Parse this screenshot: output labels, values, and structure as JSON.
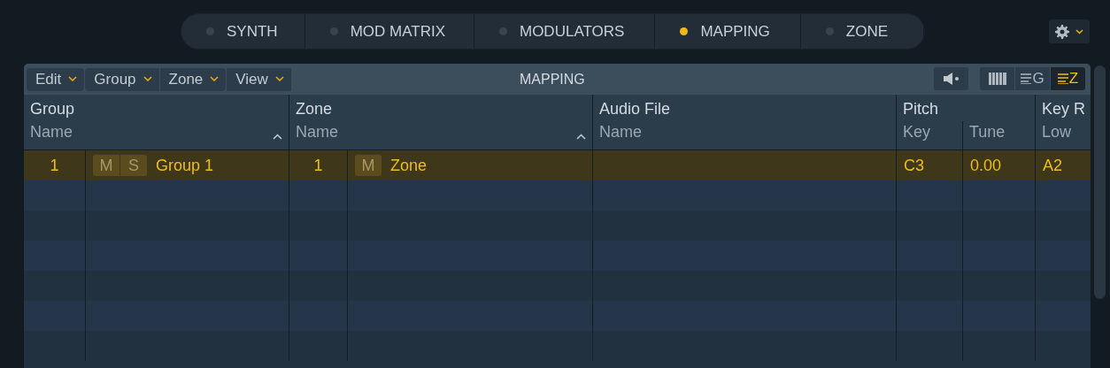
{
  "tabs": [
    {
      "label": "SYNTH",
      "selected": false
    },
    {
      "label": "MOD MATRIX",
      "selected": false
    },
    {
      "label": "MODULATORS",
      "selected": false
    },
    {
      "label": "MAPPING",
      "selected": true
    },
    {
      "label": "ZONE",
      "selected": false
    }
  ],
  "panel": {
    "menus": [
      "Edit",
      "Group",
      "Zone",
      "View"
    ],
    "title": "MAPPING",
    "view_modes": [
      {
        "kind": "keyboard",
        "selected": false
      },
      {
        "kind": "group",
        "label": "G",
        "selected": false
      },
      {
        "kind": "zone",
        "label": "Z",
        "selected": true
      }
    ]
  },
  "table": {
    "column_groups": [
      {
        "label": "Group",
        "columns": [
          {
            "label": "Name",
            "sorted": true
          }
        ]
      },
      {
        "label": "Zone",
        "columns": [
          {
            "label": "Name",
            "sorted": true
          }
        ]
      },
      {
        "label": "Audio File",
        "columns": [
          {
            "label": "Name",
            "sorted": false
          }
        ]
      },
      {
        "label": "Pitch",
        "columns": [
          {
            "label": "Key",
            "sorted": false
          },
          {
            "label": "Tune",
            "sorted": false
          }
        ]
      },
      {
        "label": "Key R",
        "columns": [
          {
            "label": "Low",
            "sorted": false
          }
        ]
      }
    ],
    "rows": [
      {
        "group_number": "1",
        "group_mute": "M",
        "group_solo": "S",
        "group_name": "Group 1",
        "zone_number": "1",
        "zone_mute": "M",
        "zone_name": "Zone",
        "key": "C3",
        "tune": "0.00",
        "low": "A2",
        "selected": true
      }
    ]
  }
}
